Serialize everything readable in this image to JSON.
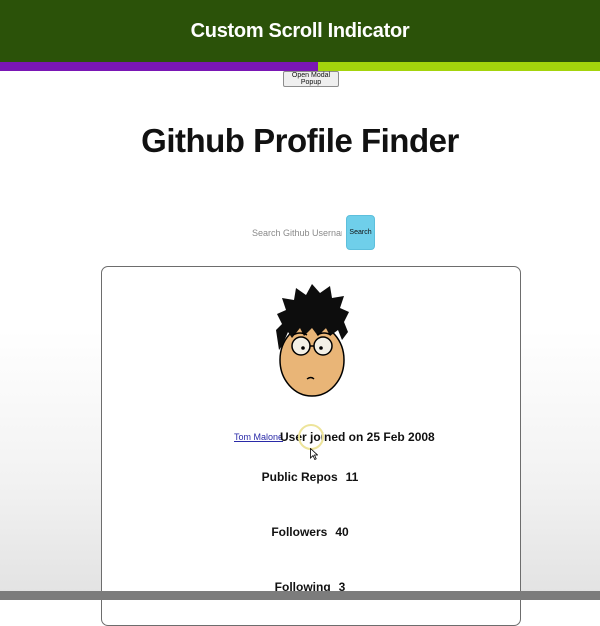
{
  "header": {
    "title": "Custom Scroll Indicator",
    "bg_color": "#2b5209",
    "scroll_progress_percent": 53,
    "scroll_fill_color": "#7a16b5",
    "scroll_track_color": "#a4d40c"
  },
  "modal_button": {
    "label": "Open Modal Popup"
  },
  "main": {
    "title": "Github Profile Finder"
  },
  "search": {
    "placeholder": "Search Github Username...",
    "value": "",
    "button_label": "Search",
    "button_color": "#6fcfea"
  },
  "profile": {
    "avatar_icon": "cartoon-avatar-icon",
    "username": "Tom Malone",
    "joined": "User joined on 25 Feb 2008",
    "stats": [
      {
        "label": "Public Repos",
        "value": "11"
      },
      {
        "label": "Followers",
        "value": "40"
      },
      {
        "label": "Following",
        "value": "3"
      }
    ]
  }
}
